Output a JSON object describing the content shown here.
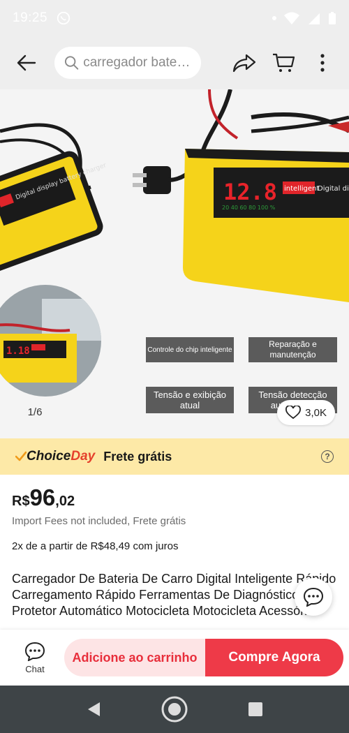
{
  "status_bar": {
    "time": "19:25"
  },
  "search": {
    "placeholder": "carregador bateri..."
  },
  "gallery": {
    "counter": "1/6",
    "wishlist_count": "3,0K",
    "tags": [
      "Controle do chip inteligente",
      "Reparação e manutenção",
      "Tensão e exibição atual",
      "Tensão detecção automática"
    ],
    "device_screen": "12.8",
    "device_brand": "intelligent",
    "device_label": "Digital display"
  },
  "choice_banner": {
    "logo_choice": "Choice",
    "logo_day": "Day",
    "text": "Frete grátis",
    "help": "?"
  },
  "price": {
    "currency": "R$",
    "integer": "96",
    "decimal": ",02"
  },
  "fees_note": "Import Fees not included, Frete grátis",
  "installment": "2x de a partir de R$48,49 com juros",
  "title": "Carregador De Bateria De Carro Digital Inteligente Rápido Carregamento Rápido Ferramentas De Diagnóstico 12V Protetor Automático Motocicleta Motocicleta Acessórios",
  "actions": {
    "chat": "Chat",
    "add_to_cart": "Adicione ao carrinho",
    "buy_now": "Compre Agora"
  },
  "colors": {
    "accent": "#ee3a48",
    "add_cart_bg": "#fde4e5",
    "choice_bg": "#fde9a7",
    "product_yellow": "#f5d31a"
  }
}
